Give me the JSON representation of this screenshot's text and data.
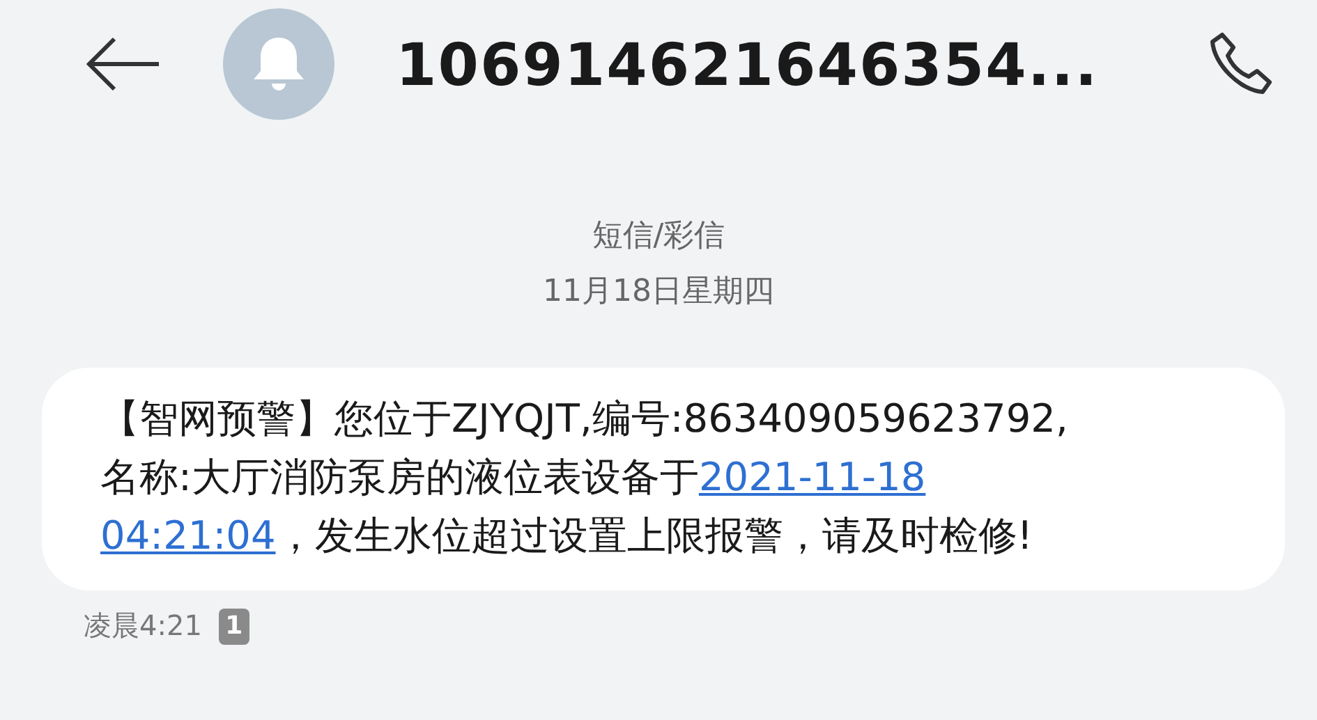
{
  "header": {
    "title": "106914621646354..."
  },
  "thread_info": {
    "channel": "短信/彩信",
    "date": "11月18日星期四"
  },
  "message": {
    "lines": [
      [
        {
          "kind": "text",
          "text": "【智网预警】您位于ZJYQJT,编号:863409059623792,"
        }
      ],
      [
        {
          "kind": "text",
          "text": "名称:大厅消防泵房的液位表设备于"
        },
        {
          "kind": "link",
          "text": "2021-11-18"
        }
      ],
      [
        {
          "kind": "link",
          "text": "04:21:04"
        },
        {
          "kind": "text",
          "text": "，发生水位超过设置上限报警，请及时检修!"
        }
      ]
    ],
    "time": "凌晨4:21",
    "sim": "1"
  }
}
